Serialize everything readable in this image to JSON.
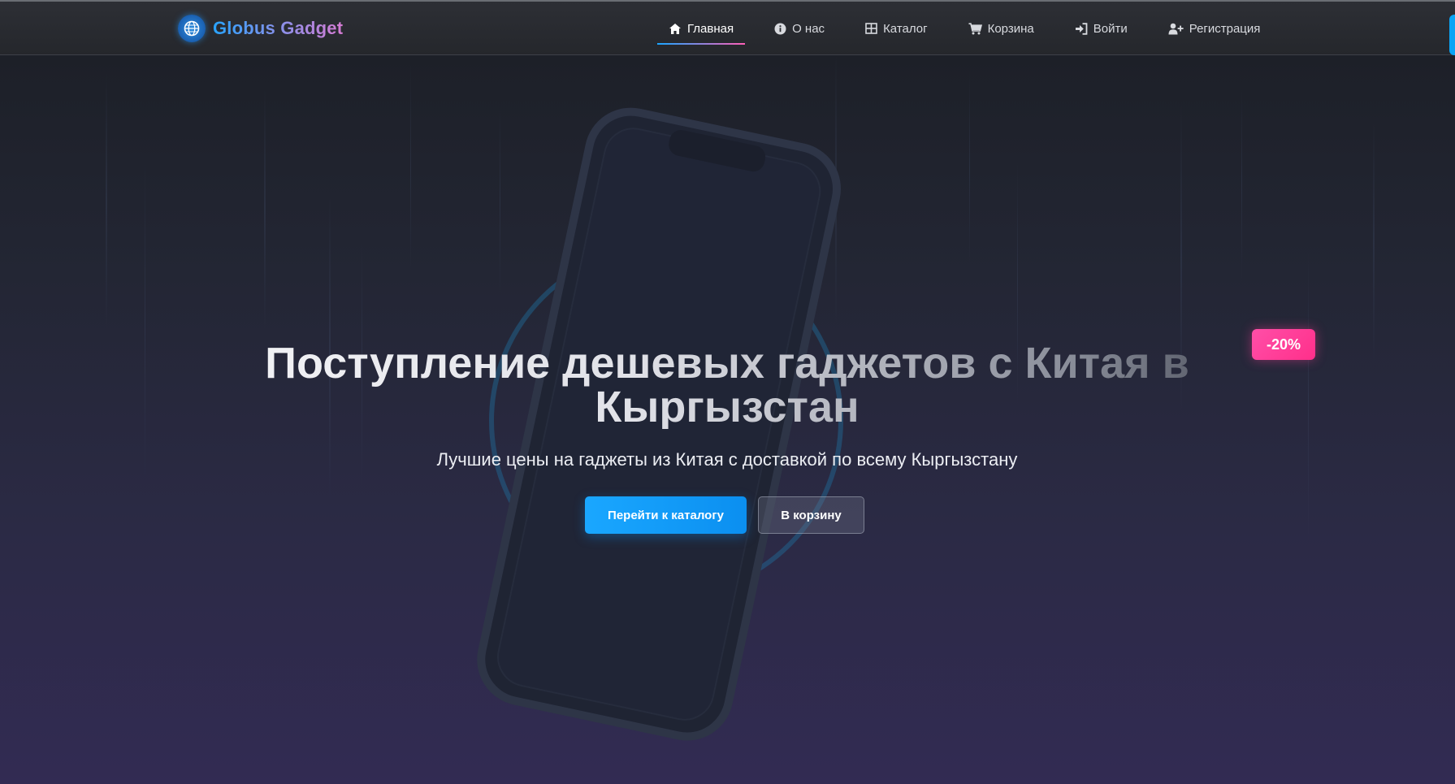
{
  "brand": {
    "name": "Globus Gadget",
    "icon": "globe-icon"
  },
  "nav": {
    "items": [
      {
        "label": "Главная",
        "icon": "home-icon",
        "active": true
      },
      {
        "label": "О нас",
        "icon": "info-icon",
        "active": false
      },
      {
        "label": "Каталог",
        "icon": "grid-icon",
        "active": false
      },
      {
        "label": "Корзина",
        "icon": "cart-icon",
        "active": false
      },
      {
        "label": "Войти",
        "icon": "sign-in-icon",
        "active": false
      },
      {
        "label": "Регистрация",
        "icon": "user-plus-icon",
        "active": false
      }
    ]
  },
  "hero": {
    "title": "Поступление дешевых гаджетов с Китая в Кыргызстан",
    "subtitle": "Лучшие цены на гаджеты из Китая с доставкой по всему Кыргызстану",
    "primary_button": "Перейти к каталогу",
    "secondary_button": "В корзину",
    "badge": "-20%"
  },
  "colors": {
    "accent": "#0aa4f5",
    "badge": "#ff3f95",
    "nav_bg": "#2a2c31",
    "hero_bg_top": "#1d2028",
    "hero_bg_bottom": "#322b53"
  }
}
